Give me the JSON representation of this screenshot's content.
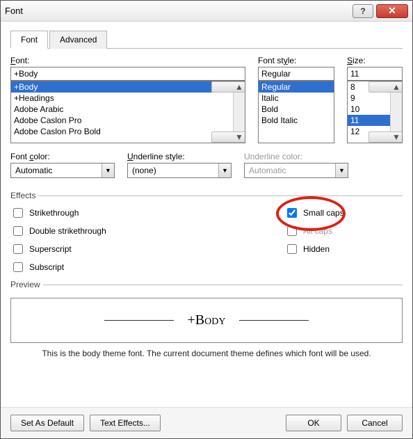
{
  "window": {
    "title": "Font"
  },
  "titlebuttons": {
    "help": "?",
    "close": "✕"
  },
  "tabs": {
    "font": "Font",
    "advanced": "Advanced"
  },
  "font": {
    "label": "Font:",
    "value": "+Body",
    "options": [
      "+Body",
      "+Headings",
      "Adobe Arabic",
      "Adobe Caslon Pro",
      "Adobe Caslon Pro Bold"
    ]
  },
  "style": {
    "label": "Font style:",
    "value": "Regular",
    "options": [
      "Regular",
      "Italic",
      "Bold",
      "Bold Italic"
    ]
  },
  "size": {
    "label": "Size:",
    "value": "11",
    "options": [
      "8",
      "9",
      "10",
      "11",
      "12"
    ]
  },
  "fontcolor": {
    "label": "Font color:",
    "value": "Automatic"
  },
  "ustyle": {
    "label": "Underline style:",
    "value": "(none)"
  },
  "ucolor": {
    "label": "Underline color:",
    "value": "Automatic"
  },
  "effects": {
    "legend": "Effects",
    "strike": "Strikethrough",
    "dstrike": "Double strikethrough",
    "sup": "Superscript",
    "sub": "Subscript",
    "smallcaps": "Small caps",
    "allcaps": "All caps",
    "hidden": "Hidden"
  },
  "preview": {
    "legend": "Preview",
    "text": "+Body",
    "desc": "This is the body theme font. The current document theme defines which font will be used."
  },
  "buttons": {
    "default": "Set As Default",
    "texteffects": "Text Effects...",
    "ok": "OK",
    "cancel": "Cancel"
  }
}
